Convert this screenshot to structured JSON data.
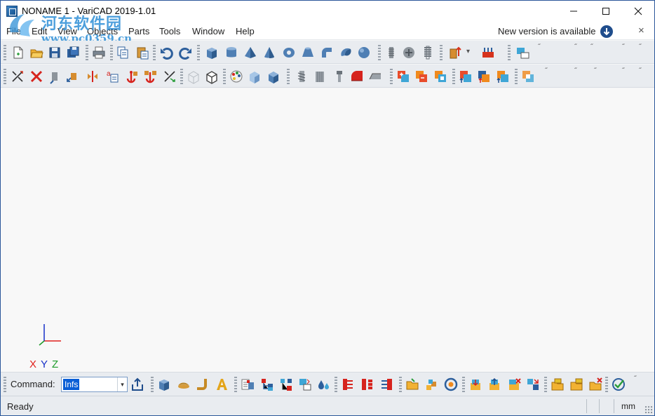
{
  "window": {
    "title": "NONAME 1 - VariCAD 2019-1.01",
    "min_icon": "minimize-icon",
    "max_icon": "maximize-icon",
    "close_icon": "close-icon"
  },
  "watermark": {
    "line1": "河东软件园",
    "line2": "www.pc0359.cn"
  },
  "menu": {
    "items": [
      "File",
      "Edit",
      "View",
      "Objects",
      "Parts",
      "Tools",
      "Window",
      "Help"
    ],
    "new_version": "New version is available",
    "close_glyph": "×"
  },
  "toolbar1": {
    "buttons": [
      {
        "name": "new-file-icon",
        "icon": "new"
      },
      {
        "name": "open-file-icon",
        "icon": "open"
      },
      {
        "name": "save-file-icon",
        "icon": "save"
      },
      {
        "name": "save-all-icon",
        "icon": "saveall"
      },
      {
        "name": "print-icon",
        "icon": "print"
      },
      {
        "name": "copy-icon",
        "icon": "copy"
      },
      {
        "name": "paste-icon",
        "icon": "paste"
      },
      {
        "name": "undo-icon",
        "icon": "undo"
      },
      {
        "name": "redo-icon",
        "icon": "redo"
      },
      {
        "name": "box-solid-icon",
        "icon": "box"
      },
      {
        "name": "cylinder-solid-icon",
        "icon": "cyl"
      },
      {
        "name": "pyramid-solid-icon",
        "icon": "pyr"
      },
      {
        "name": "cone-solid-icon",
        "icon": "cone"
      },
      {
        "name": "tube-solid-icon",
        "icon": "tube"
      },
      {
        "name": "frustum-solid-icon",
        "icon": "frust"
      },
      {
        "name": "elbow-solid-icon",
        "icon": "elbow"
      },
      {
        "name": "torus-solid-icon",
        "icon": "torus"
      },
      {
        "name": "sphere-solid-icon",
        "icon": "sphere"
      },
      {
        "name": "thread-icon",
        "icon": "thread"
      },
      {
        "name": "bolt-icon",
        "icon": "bolt"
      },
      {
        "name": "spring-icon",
        "icon": "spring"
      },
      {
        "name": "insert-part-icon",
        "icon": "insert"
      },
      {
        "name": "assembly-icon",
        "icon": "assembly"
      },
      {
        "name": "export-icon",
        "icon": "export"
      }
    ]
  },
  "toolbar2": {
    "buttons": [
      {
        "name": "transform-icon",
        "icon": "xform"
      },
      {
        "name": "delete-icon",
        "icon": "delete"
      },
      {
        "name": "move-icon",
        "icon": "move"
      },
      {
        "name": "copy-move-icon",
        "icon": "copymove"
      },
      {
        "name": "mirror-icon",
        "icon": "mirror"
      },
      {
        "name": "attribute-icon",
        "icon": "attr"
      },
      {
        "name": "anchor-icon",
        "icon": "anchor"
      },
      {
        "name": "anchor-multi-icon",
        "icon": "anchor2"
      },
      {
        "name": "transform-axes-icon",
        "icon": "xform2"
      },
      {
        "name": "wireframe-view-icon",
        "icon": "wire"
      },
      {
        "name": "outline-view-icon",
        "icon": "outline"
      },
      {
        "name": "color-palette-icon",
        "icon": "palette"
      },
      {
        "name": "shading-icon",
        "icon": "shade"
      },
      {
        "name": "solid-view-icon",
        "icon": "solidview"
      },
      {
        "name": "thread-view-icon",
        "icon": "thread2"
      },
      {
        "name": "hole-icon",
        "icon": "hole"
      },
      {
        "name": "screw-icon",
        "icon": "screw"
      },
      {
        "name": "fillet-icon",
        "icon": "fillet"
      },
      {
        "name": "chamfer-icon",
        "icon": "chamfer"
      },
      {
        "name": "boolean-add-icon",
        "icon": "badd"
      },
      {
        "name": "boolean-subtract-icon",
        "icon": "bsub"
      },
      {
        "name": "boolean-cut-icon",
        "icon": "bcut"
      },
      {
        "name": "boolean-add-up-icon",
        "icon": "badd2"
      },
      {
        "name": "boolean-subtract-up-icon",
        "icon": "bsub2"
      },
      {
        "name": "boolean-cut-up-icon",
        "icon": "bcut2"
      },
      {
        "name": "boolean-intersect-icon",
        "icon": "bint"
      }
    ]
  },
  "command": {
    "label": "Command:",
    "value": "Infs",
    "dropdown_glyph": "▾",
    "send_icon": "share-icon"
  },
  "cmdbar": {
    "buttons": [
      {
        "name": "solid-box-icon",
        "icon": "box"
      },
      {
        "name": "sweep-icon",
        "icon": "sweep"
      },
      {
        "name": "pipe-icon",
        "icon": "pipe"
      },
      {
        "name": "text-3d-icon",
        "icon": "text3d"
      },
      {
        "name": "bom-icon",
        "icon": "bom"
      },
      {
        "name": "layer-tree-icon",
        "icon": "tree"
      },
      {
        "name": "hierarchy-icon",
        "icon": "hier"
      },
      {
        "name": "folder-move-icon",
        "icon": "fmove"
      },
      {
        "name": "liquid-icon",
        "icon": "drop"
      },
      {
        "name": "tree-expand-icon",
        "icon": "tree1"
      },
      {
        "name": "tree-collapse-icon",
        "icon": "tree2"
      },
      {
        "name": "tree-select-icon",
        "icon": "tree3"
      },
      {
        "name": "group-open-icon",
        "icon": "gopen"
      },
      {
        "name": "group-blocks-icon",
        "icon": "gblocks"
      },
      {
        "name": "group-circle-icon",
        "icon": "gcircle"
      },
      {
        "name": "part-import-icon",
        "icon": "pimp"
      },
      {
        "name": "part-export-icon",
        "icon": "pexp"
      },
      {
        "name": "part-delete-icon",
        "icon": "pdel"
      },
      {
        "name": "part-swap-icon",
        "icon": "pswap"
      },
      {
        "name": "folder-import-icon",
        "icon": "fimp"
      },
      {
        "name": "folder-export-icon",
        "icon": "fexp"
      },
      {
        "name": "folder-delete-icon",
        "icon": "fdel"
      },
      {
        "name": "check-icon",
        "icon": "check"
      }
    ]
  },
  "axis": {
    "x": "X",
    "y": "Y",
    "z": "Z",
    "x_color": "#e0201c",
    "y_color": "#1730c8",
    "z_color": "#1d9b2a"
  },
  "status": {
    "text": "Ready",
    "unit": "mm"
  },
  "colors": {
    "accent": "#1f4d8c",
    "toolbar_bg": "#e9ecf0",
    "selection": "#0a5fd6"
  }
}
